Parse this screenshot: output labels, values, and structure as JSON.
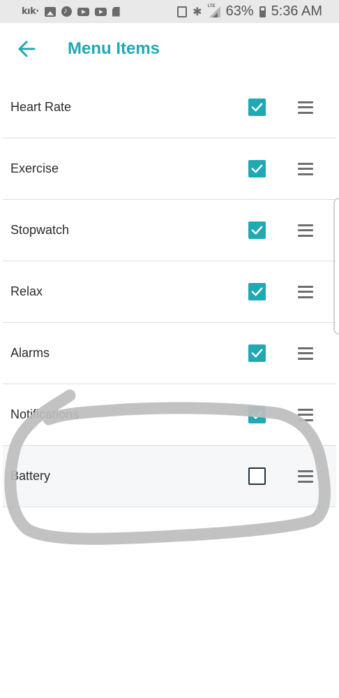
{
  "status_bar": {
    "left_icons": [
      "kik-icon",
      "gallery-icon",
      "music-icon",
      "youtube-icon",
      "youtube-icon",
      "sd-card-icon"
    ],
    "kik_text": "kık·",
    "battery_percent": "63%",
    "time": "5:36 AM",
    "network_label": "LTE"
  },
  "header": {
    "title": "Menu Items",
    "back_icon": "arrow-left-icon",
    "accent_color": "#20a8b3"
  },
  "menu_items": [
    {
      "label": "Heart Rate",
      "checked": true
    },
    {
      "label": "Exercise",
      "checked": true
    },
    {
      "label": "Stopwatch",
      "checked": true
    },
    {
      "label": "Relax",
      "checked": true
    },
    {
      "label": "Alarms",
      "checked": true
    },
    {
      "label": "Notifications",
      "checked": true
    },
    {
      "label": "Battery",
      "checked": false
    }
  ],
  "colors": {
    "checkbox_checked": "#1fa9b2",
    "annotation_stroke": "#bdbdbd"
  }
}
